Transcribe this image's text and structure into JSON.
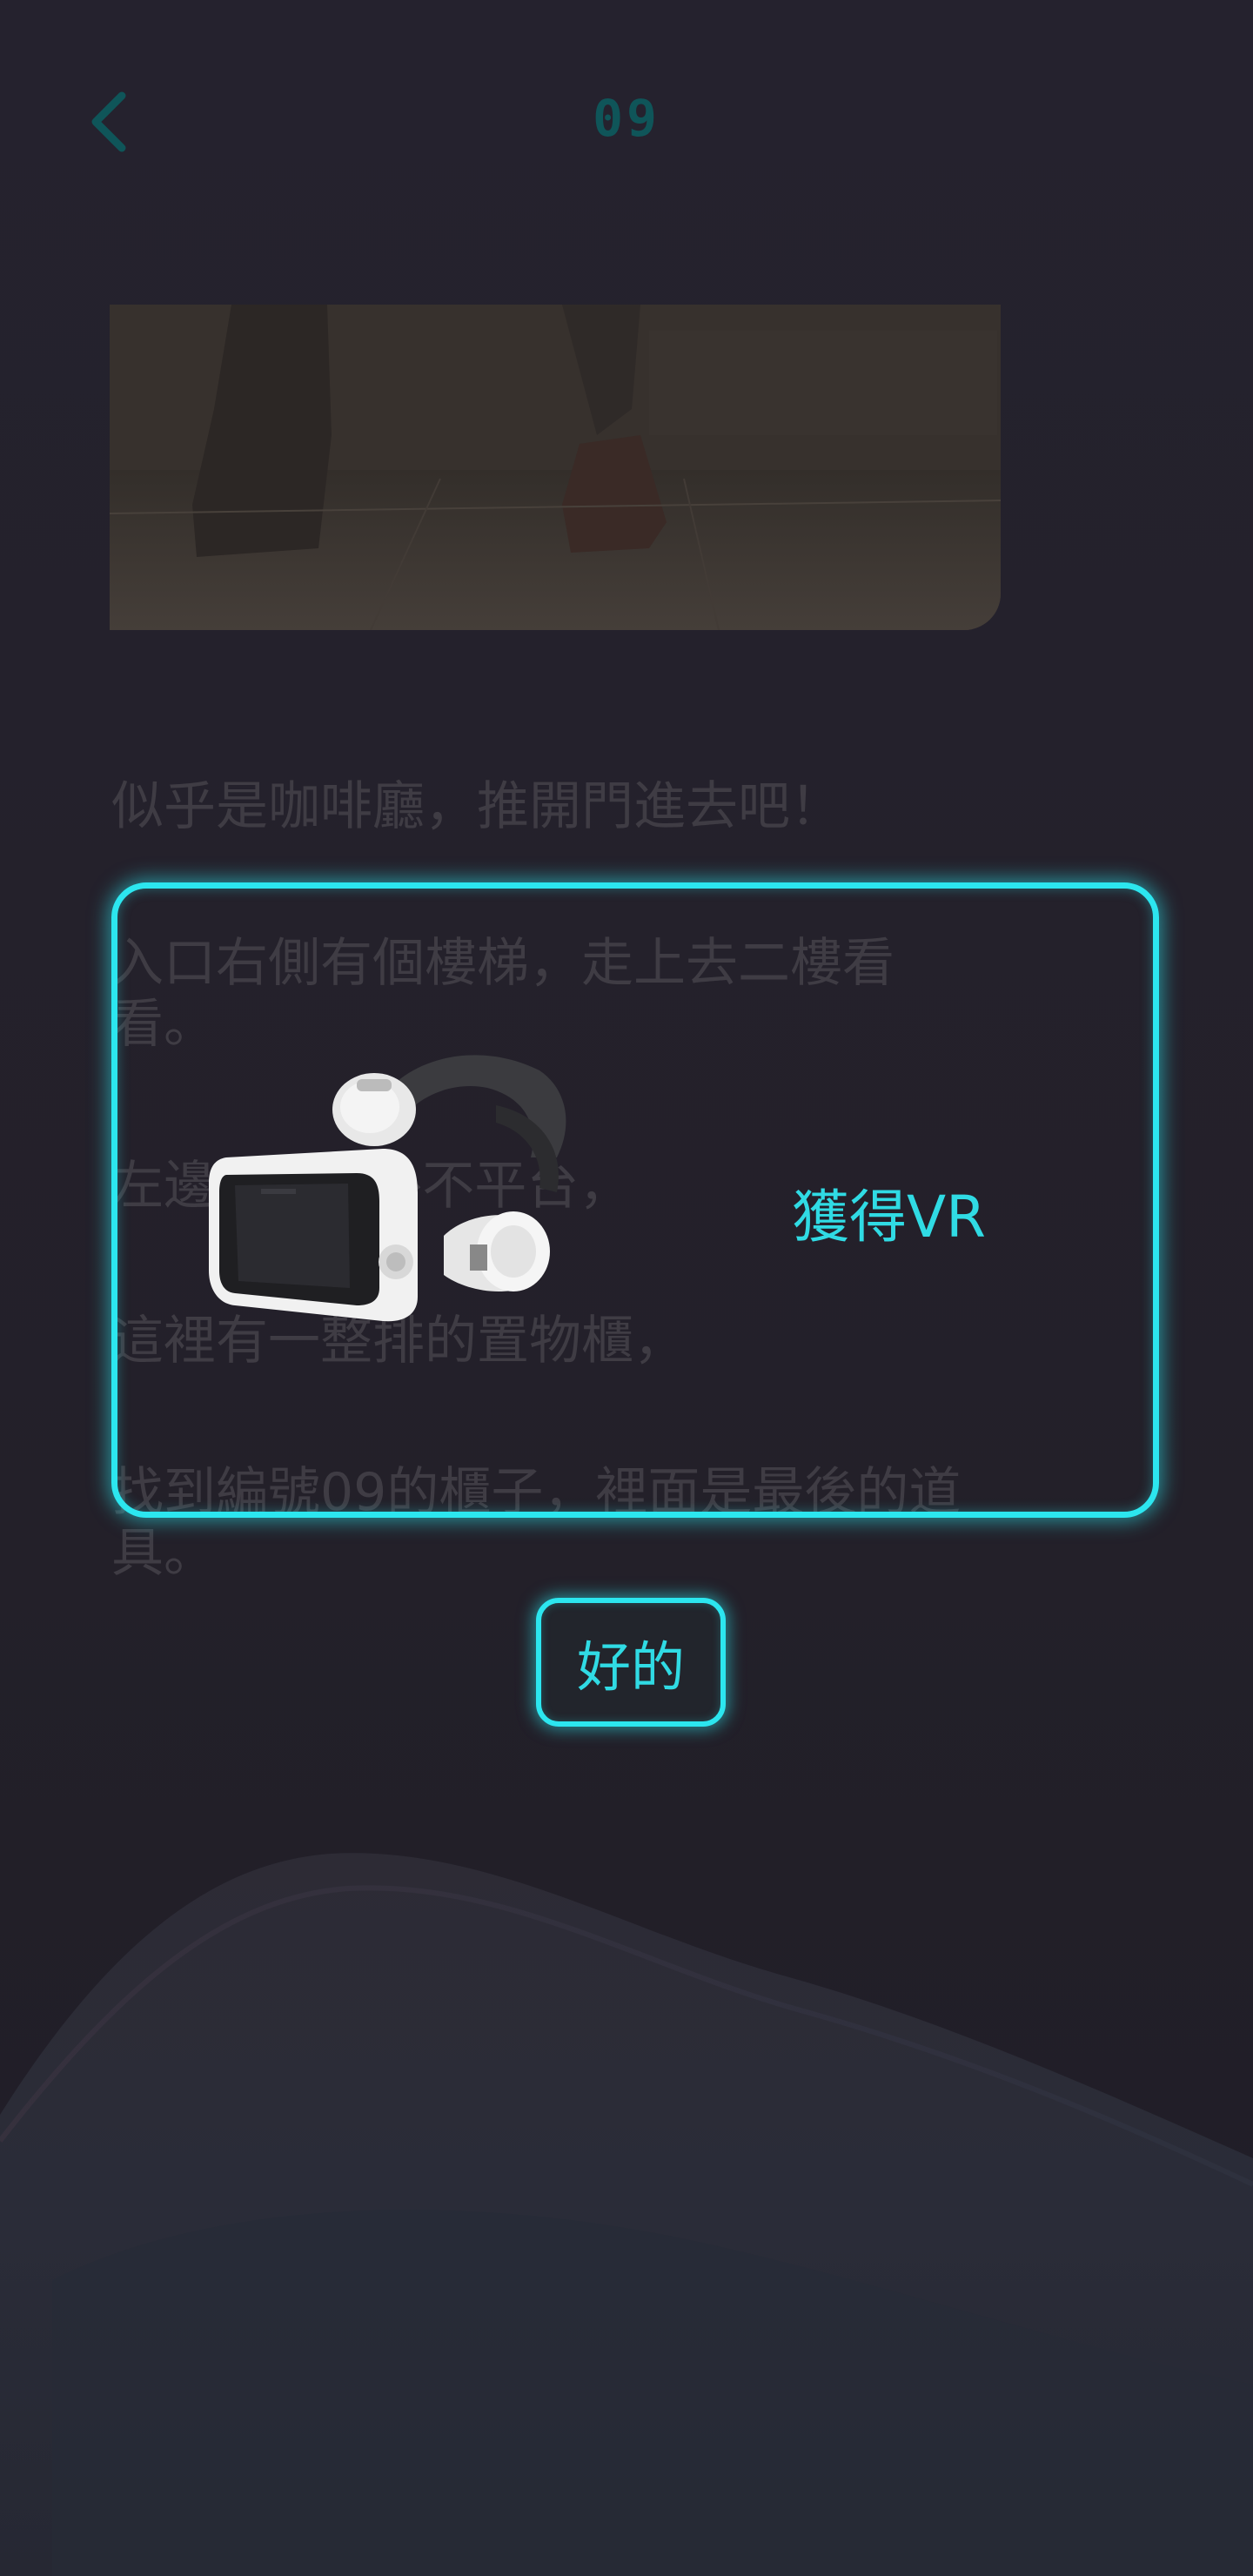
{
  "header": {
    "back_icon": "chevron-left-icon",
    "title": "09"
  },
  "story": {
    "paragraphs": [
      "似乎是咖啡廳，推開門進去吧！",
      "入口右側有個樓梯，走上去二樓看看。",
      "左邊...往室外不平台，",
      "這裡有一整排的置物櫃，",
      "找到編號09的櫃子，裡面是最後的道具。"
    ]
  },
  "dialog": {
    "item_icon": "vr-headset-image",
    "acquired_text": "獲得VR",
    "ok_label": "好的"
  },
  "colors": {
    "background": "#22202b",
    "accent": "#2ce6ef",
    "title_color": "#0f5559",
    "dim_text": "#3f3c44"
  }
}
